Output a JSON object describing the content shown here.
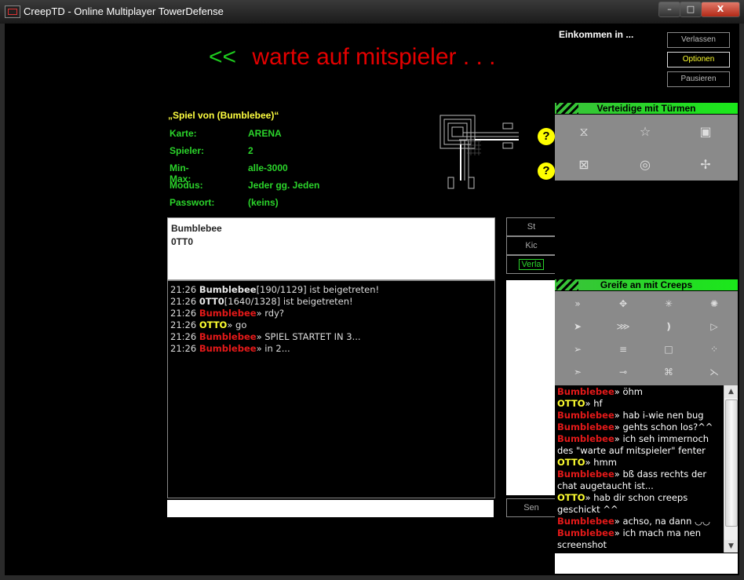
{
  "window": {
    "title": "CreepTD - Online Multiplayer TowerDefense",
    "min_label": "–",
    "max_label": "□",
    "close_label": "X"
  },
  "waiting": {
    "arrows": "<<",
    "message": "warte  auf  mitspieler . . ."
  },
  "game": {
    "title": "„Spiel von (Bumblebee)“",
    "info": [
      {
        "label": "Karte:",
        "value": "ARENA"
      },
      {
        "label": "Spieler:",
        "value": "2"
      },
      {
        "label": "Min-Max:",
        "value": "alle-3000"
      },
      {
        "label": "Modus:",
        "value": "Jeder gg. Jeden"
      },
      {
        "label": "Passwort:",
        "value": "(keins)"
      }
    ]
  },
  "players": [
    "Bumblebee",
    "0TT0"
  ],
  "lobby_buttons": {
    "start": "St",
    "kick": "Kic",
    "leave": "Verla",
    "send": "Sen"
  },
  "lobby_chat": [
    {
      "time": "21:26",
      "name": "Bumblebee",
      "color": "white",
      "text": "[190/1129] ist beigetreten!"
    },
    {
      "time": "21:26",
      "name": "0TT0",
      "color": "white",
      "text": "[1640/1328] ist beigetreten!"
    },
    {
      "time": "21:26",
      "name": "Bumblebee",
      "color": "red",
      "text": "» rdy?"
    },
    {
      "time": "21:26",
      "name": "OTTO",
      "color": "yellow",
      "text": "» go"
    },
    {
      "time": "21:26",
      "name": "Bumblebee",
      "color": "red",
      "text": "» SPIEL STARTET IN 3..."
    },
    {
      "time": "21:26",
      "name": "Bumblebee",
      "color": "red",
      "text": "» in 2..."
    }
  ],
  "right_panel": {
    "income_label": "Einkommen in ...",
    "buttons": {
      "leave": "Verlassen",
      "options": "Optionen",
      "pause": "Pausieren"
    },
    "towers_heading": "Verteidige mit Türmen",
    "creeps_heading": "Greife an mit Creeps",
    "tower_icons": [
      "hourglass-icon",
      "star-icon",
      "square-target-icon",
      "x-box-icon",
      "ring-target-icon",
      "compass-icon"
    ],
    "creep_icons": [
      "double-chevron-icon",
      "plus-cross-icon",
      "asterisk-icon",
      "burst-icon",
      "arrow-head-icon",
      "fish-icon",
      "double-bracket-icon",
      "triangle-icon",
      "dart-icon",
      "lines-icon",
      "square-icon",
      "dots-icon",
      "small-arrow-icon",
      "circle-arrow-icon",
      "spider-icon",
      "fork-icon"
    ]
  },
  "game_chat": [
    {
      "name": "Bumblebee",
      "color": "red",
      "text": "» öhm"
    },
    {
      "name": "OTTO",
      "color": "yellow",
      "text": "» hf"
    },
    {
      "name": "Bumblebee",
      "color": "red",
      "text": "» hab i-wie nen bug"
    },
    {
      "name": "Bumblebee",
      "color": "red",
      "text": "» gehts schon los?^^"
    },
    {
      "name": "Bumblebee",
      "color": "red",
      "text": "» ich seh immernoch"
    },
    {
      "name": "",
      "color": "white",
      "text": "des \"warte auf mitspieler\" fenter"
    },
    {
      "name": "OTTO",
      "color": "yellow",
      "text": "» hmm"
    },
    {
      "name": "Bumblebee",
      "color": "red",
      "text": "» bß dass rechts der"
    },
    {
      "name": "",
      "color": "white",
      "text": "chat augetaucht ist..."
    },
    {
      "name": "OTTO",
      "color": "yellow",
      "text": "» hab dir schon creeps"
    },
    {
      "name": "",
      "color": "white",
      "text": "geschickt ^^"
    },
    {
      "name": "Bumblebee",
      "color": "red",
      "text": "» achso, na dann ◡◡"
    },
    {
      "name": "Bumblebee",
      "color": "red",
      "text": "» ich mach ma nen"
    },
    {
      "name": "",
      "color": "white",
      "text": "screenshot"
    }
  ]
}
